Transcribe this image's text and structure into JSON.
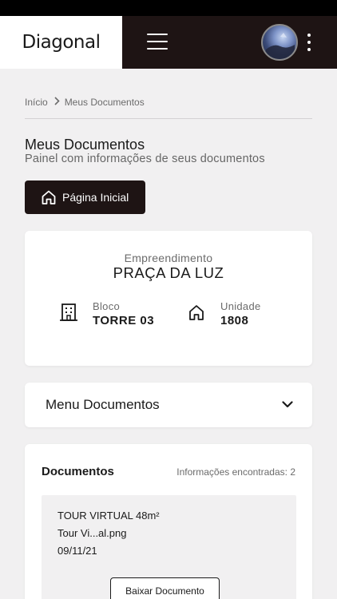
{
  "header": {
    "logo_text": "Diagonal",
    "menu_icon": "hamburger-menu-icon",
    "more_icon": "kebab-menu-icon"
  },
  "breadcrumb": {
    "home": "Início",
    "current": "Meus Documentos"
  },
  "page": {
    "title": "Meus Documentos",
    "subtitle": "Painel com informações de seus documentos"
  },
  "home_button": {
    "label": "Página Inicial",
    "icon": "home-icon"
  },
  "empreendimento": {
    "label": "Empreendimento",
    "value": "PRAÇA DA LUZ",
    "bloco_label": "Bloco",
    "bloco_value": "TORRE 03",
    "unidade_label": "Unidade",
    "unidade_value": "1808"
  },
  "menu_documentos": {
    "title": "Menu Documentos"
  },
  "documentos": {
    "title": "Documentos",
    "count_text": "Informações encontradas: 2",
    "items": [
      {
        "name": "TOUR VIRTUAL 48m²",
        "file": "Tour Vi...al.png",
        "date": "09/11/21",
        "button": "Baixar Documento"
      }
    ]
  },
  "colors": {
    "header_bg": "#1e1414",
    "page_bg": "#f1f0f1",
    "card_bg": "#ffffff"
  }
}
